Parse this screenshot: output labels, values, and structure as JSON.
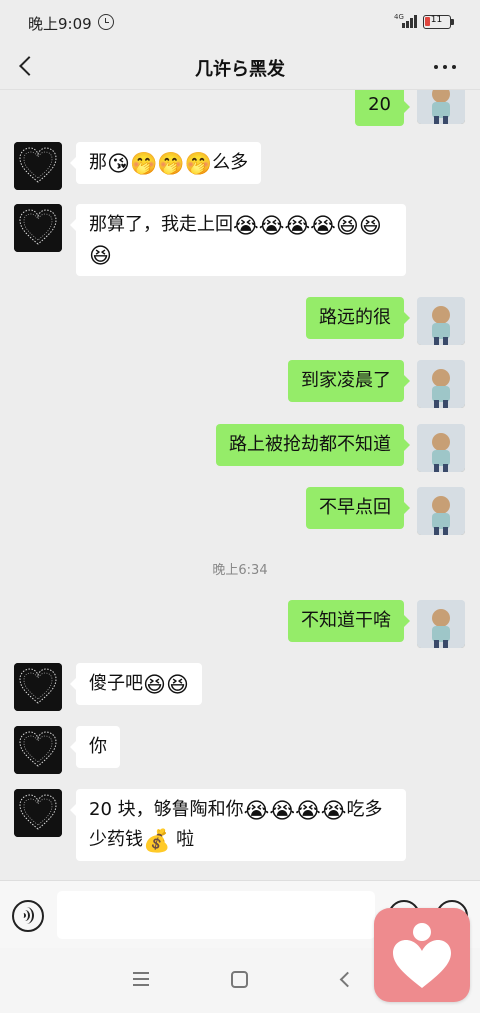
{
  "status_bar": {
    "time": "晚上9:09",
    "network": "4G",
    "battery": "11"
  },
  "nav": {
    "title": "几许ら黑发"
  },
  "messages": [
    {
      "side": "out",
      "text": "20"
    },
    {
      "side": "in",
      "parts": [
        {
          "t": "那"
        },
        {
          "e": "😘"
        },
        {
          "e": "🤭"
        },
        {
          "e": "🤭"
        },
        {
          "e": "🤭"
        },
        {
          "t": "么多"
        }
      ]
    },
    {
      "side": "in",
      "parts": [
        {
          "t": "那算了，我走上回"
        },
        {
          "e": "😭"
        },
        {
          "e": "😭"
        },
        {
          "e": "😭"
        },
        {
          "e": "😭"
        },
        {
          "e": "😆"
        },
        {
          "e": "😆"
        },
        {
          "e": "😆"
        }
      ]
    },
    {
      "side": "out",
      "text": "路远的很"
    },
    {
      "side": "out",
      "text": "到家凌晨了"
    },
    {
      "side": "out",
      "text": "路上被抢劫都不知道"
    },
    {
      "side": "out",
      "text": "不早点回"
    },
    {
      "side": "out",
      "text": "不知道干啥"
    },
    {
      "side": "in",
      "parts": [
        {
          "t": "傻子吧"
        },
        {
          "e": "😆"
        },
        {
          "e": "😆"
        }
      ]
    },
    {
      "side": "in",
      "text": "你"
    },
    {
      "side": "in",
      "parts": [
        {
          "t": "20 块，够鲁陶和你"
        },
        {
          "e": "😭"
        },
        {
          "e": "😭"
        },
        {
          "e": "😭"
        },
        {
          "e": "😭"
        },
        {
          "t": "吃多少药钱"
        },
        {
          "e": "💰"
        },
        {
          "t": " 啦"
        }
      ]
    }
  ],
  "timestamp": "晚上6:34",
  "input": {
    "value": "",
    "placeholder": ""
  },
  "icons": {
    "back": "back-arrow-icon",
    "more": "more-dots-icon",
    "voice": "voice-icon",
    "emoji": "emoji-icon",
    "plus": "plus-icon",
    "floating": "heart-app-icon"
  },
  "colors": {
    "outgoing_bubble": "#95ec69",
    "incoming_bubble": "#ffffff",
    "background": "#ededed",
    "floating_app": "#ee8b8e"
  }
}
